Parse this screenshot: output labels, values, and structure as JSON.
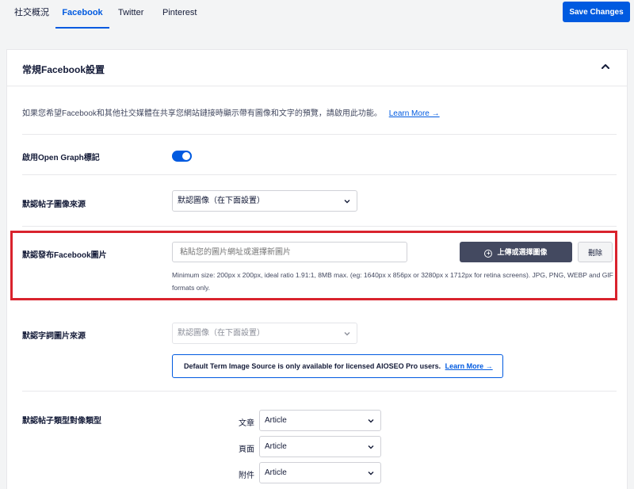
{
  "tabs": [
    {
      "label": "社交概況",
      "active": false
    },
    {
      "label": "Facebook",
      "active": true
    },
    {
      "label": "Twitter",
      "active": false
    },
    {
      "label": "Pinterest",
      "active": false
    }
  ],
  "toolbar": {
    "save_label": "Save Changes"
  },
  "card": {
    "title": "常規Facebook設置",
    "description": "如果您希望Facebook和其他社交媒體在共享您網站鏈接時顯示帶有圖像和文字的預覽，請啟用此功能。",
    "learn_more": "Learn More →"
  },
  "open_graph": {
    "label": "啟用Open Graph標記",
    "enabled": true
  },
  "post_image_source": {
    "label": "默認帖子圖像來源",
    "value": "默認圖像（在下面設置）"
  },
  "default_image": {
    "label": "默認發布Facebook圖片",
    "placeholder": "粘貼您的圖片網址或選擇新圖片",
    "upload_label": "上傳或選擇圖像",
    "delete_label": "刪除",
    "hint": "Minimum size: 200px x 200px, ideal ratio 1.91:1, 8MB max. (eg: 1640px x 856px or 3280px x 1712px for retina screens). JPG, PNG, WEBP and GIF formats only."
  },
  "term_image_source": {
    "label": "默認字詞圖片來源",
    "value": "默認圖像（在下面設置）",
    "notice": "Default Term Image Source is only available for licensed AIOSEO Pro users.",
    "notice_link": "Learn More →"
  },
  "object_types": {
    "label": "默認帖子類型對像類型",
    "rows": [
      {
        "label": "文章",
        "value": "Article"
      },
      {
        "label": "頁面",
        "value": "Article"
      },
      {
        "label": "附件",
        "value": "Article"
      }
    ]
  },
  "colors": {
    "accent": "#005ae0",
    "highlight": "#d9232d",
    "dark_button": "#434960"
  },
  "icons": {
    "collapse": "chevron-up-icon",
    "dropdown": "chevron-down-icon",
    "upload": "plus-circle-icon"
  }
}
